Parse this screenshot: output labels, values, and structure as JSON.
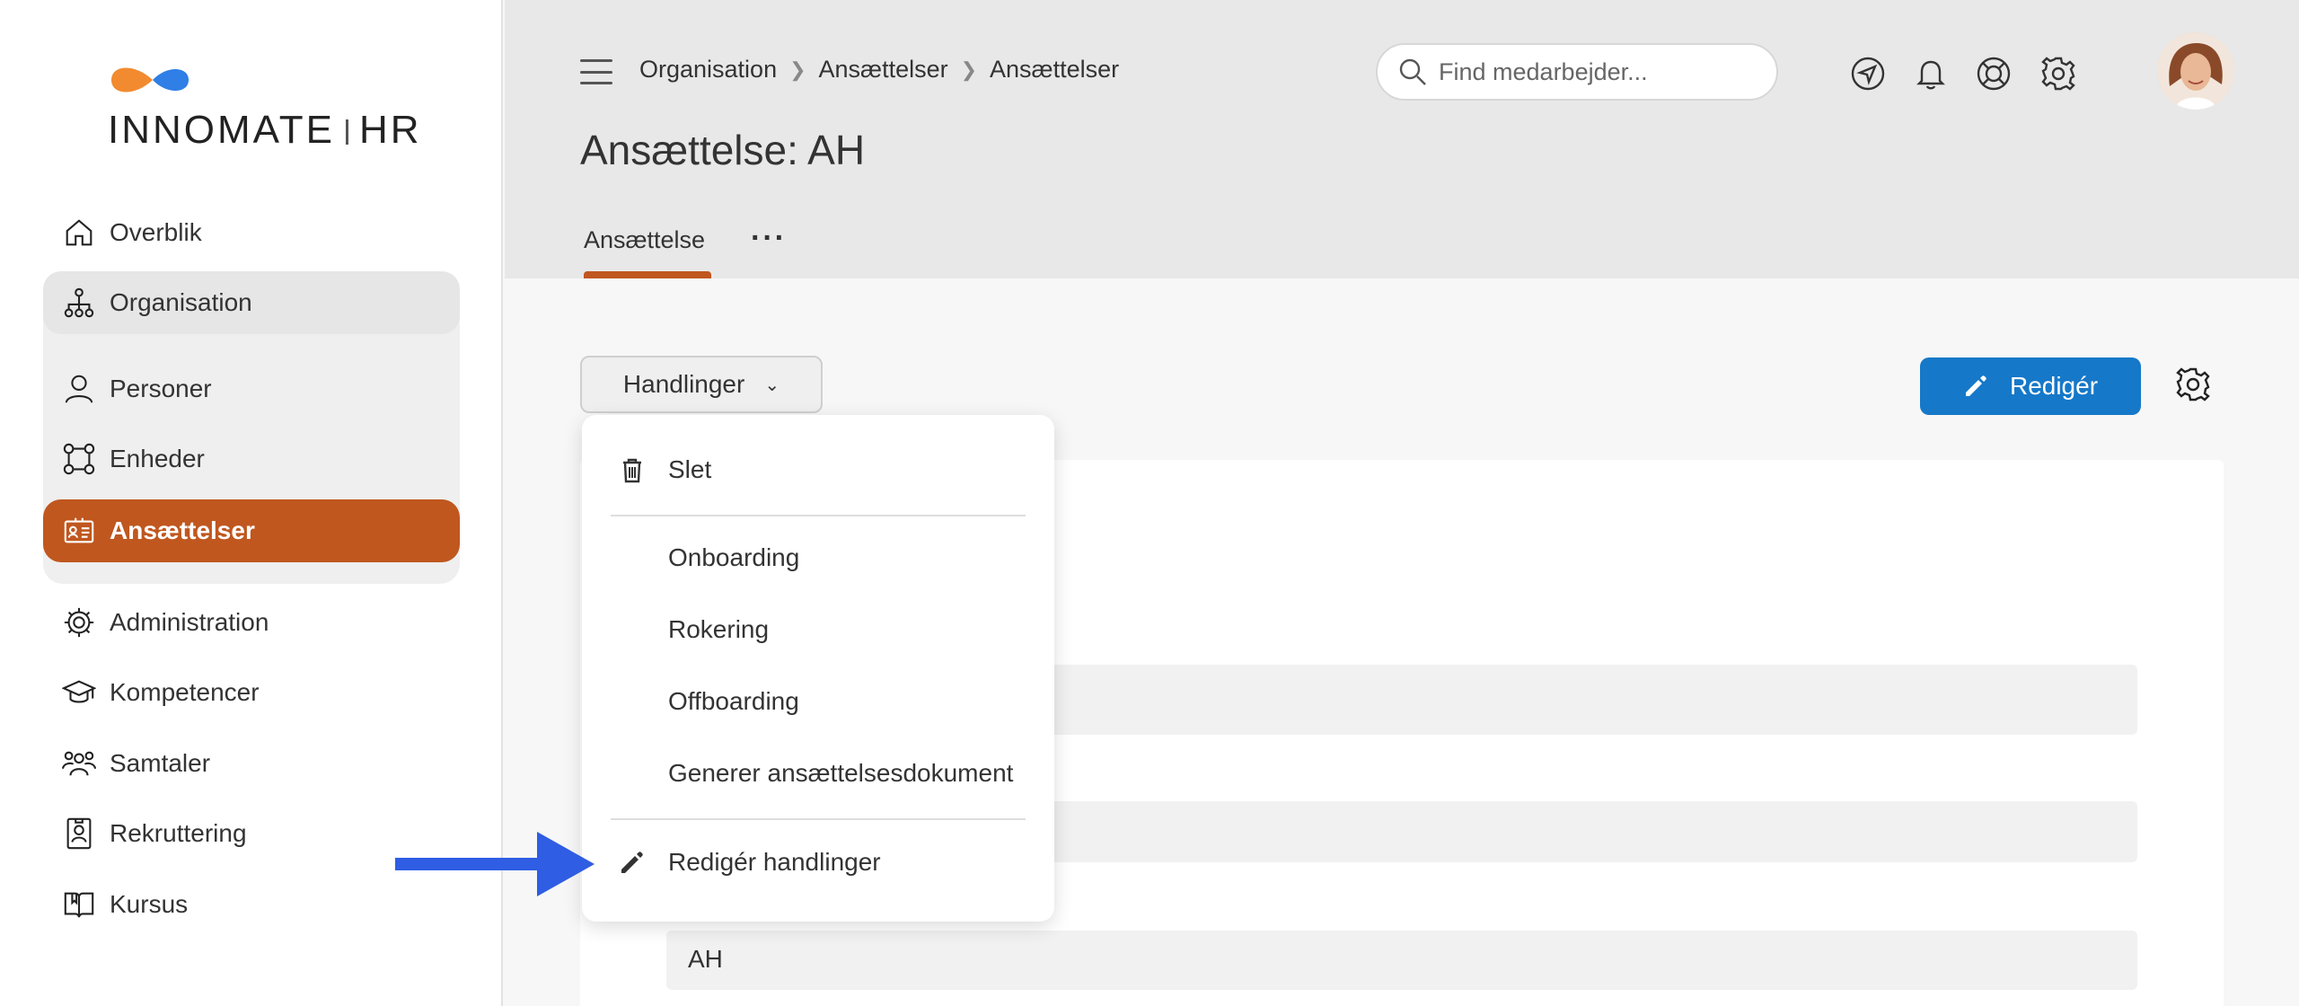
{
  "brand": {
    "name_left": "INNOMATE",
    "name_right": "HR",
    "colors": {
      "orange": "#f28b30",
      "blue": "#2f7fe6"
    }
  },
  "sidebar": {
    "items": [
      {
        "label": "Overblik",
        "icon": "home-icon"
      },
      {
        "label": "Organisation",
        "icon": "org-chart-icon"
      },
      {
        "label": "Personer",
        "icon": "person-icon"
      },
      {
        "label": "Enheder",
        "icon": "units-icon"
      },
      {
        "label": "Ansættelser",
        "icon": "id-card-icon",
        "active": true
      },
      {
        "label": "Administration",
        "icon": "admin-gear-icon"
      },
      {
        "label": "Kompetencer",
        "icon": "graduation-cap-icon"
      },
      {
        "label": "Samtaler",
        "icon": "people-group-icon"
      },
      {
        "label": "Rekruttering",
        "icon": "badge-icon"
      },
      {
        "label": "Kursus",
        "icon": "book-icon"
      }
    ],
    "active_color": "#c0571f"
  },
  "header": {
    "breadcrumb": [
      "Organisation",
      "Ansættelser",
      "Ansættelser"
    ],
    "search_placeholder": "Find medarbejder...",
    "icons": [
      "navigation-icon",
      "bell-icon",
      "lifebuoy-icon",
      "settings-icon"
    ]
  },
  "page": {
    "title": "Ansættelse: AH",
    "tabs": [
      {
        "label": "Ansættelse",
        "active": true
      }
    ],
    "more_label": "···"
  },
  "toolbar": {
    "actions_label": "Handlinger",
    "edit_label": "Redigér",
    "edit_color": "#1678c8"
  },
  "dropdown": {
    "delete_label": "Slet",
    "items": [
      "Onboarding",
      "Rokering",
      "Offboarding",
      "Generer ansættelsesdokument"
    ],
    "edit_actions_label": "Redigér handlinger"
  },
  "form": {
    "fields": [
      "",
      "",
      "AH"
    ]
  },
  "annotation": {
    "arrow_color": "#2f5de3"
  }
}
